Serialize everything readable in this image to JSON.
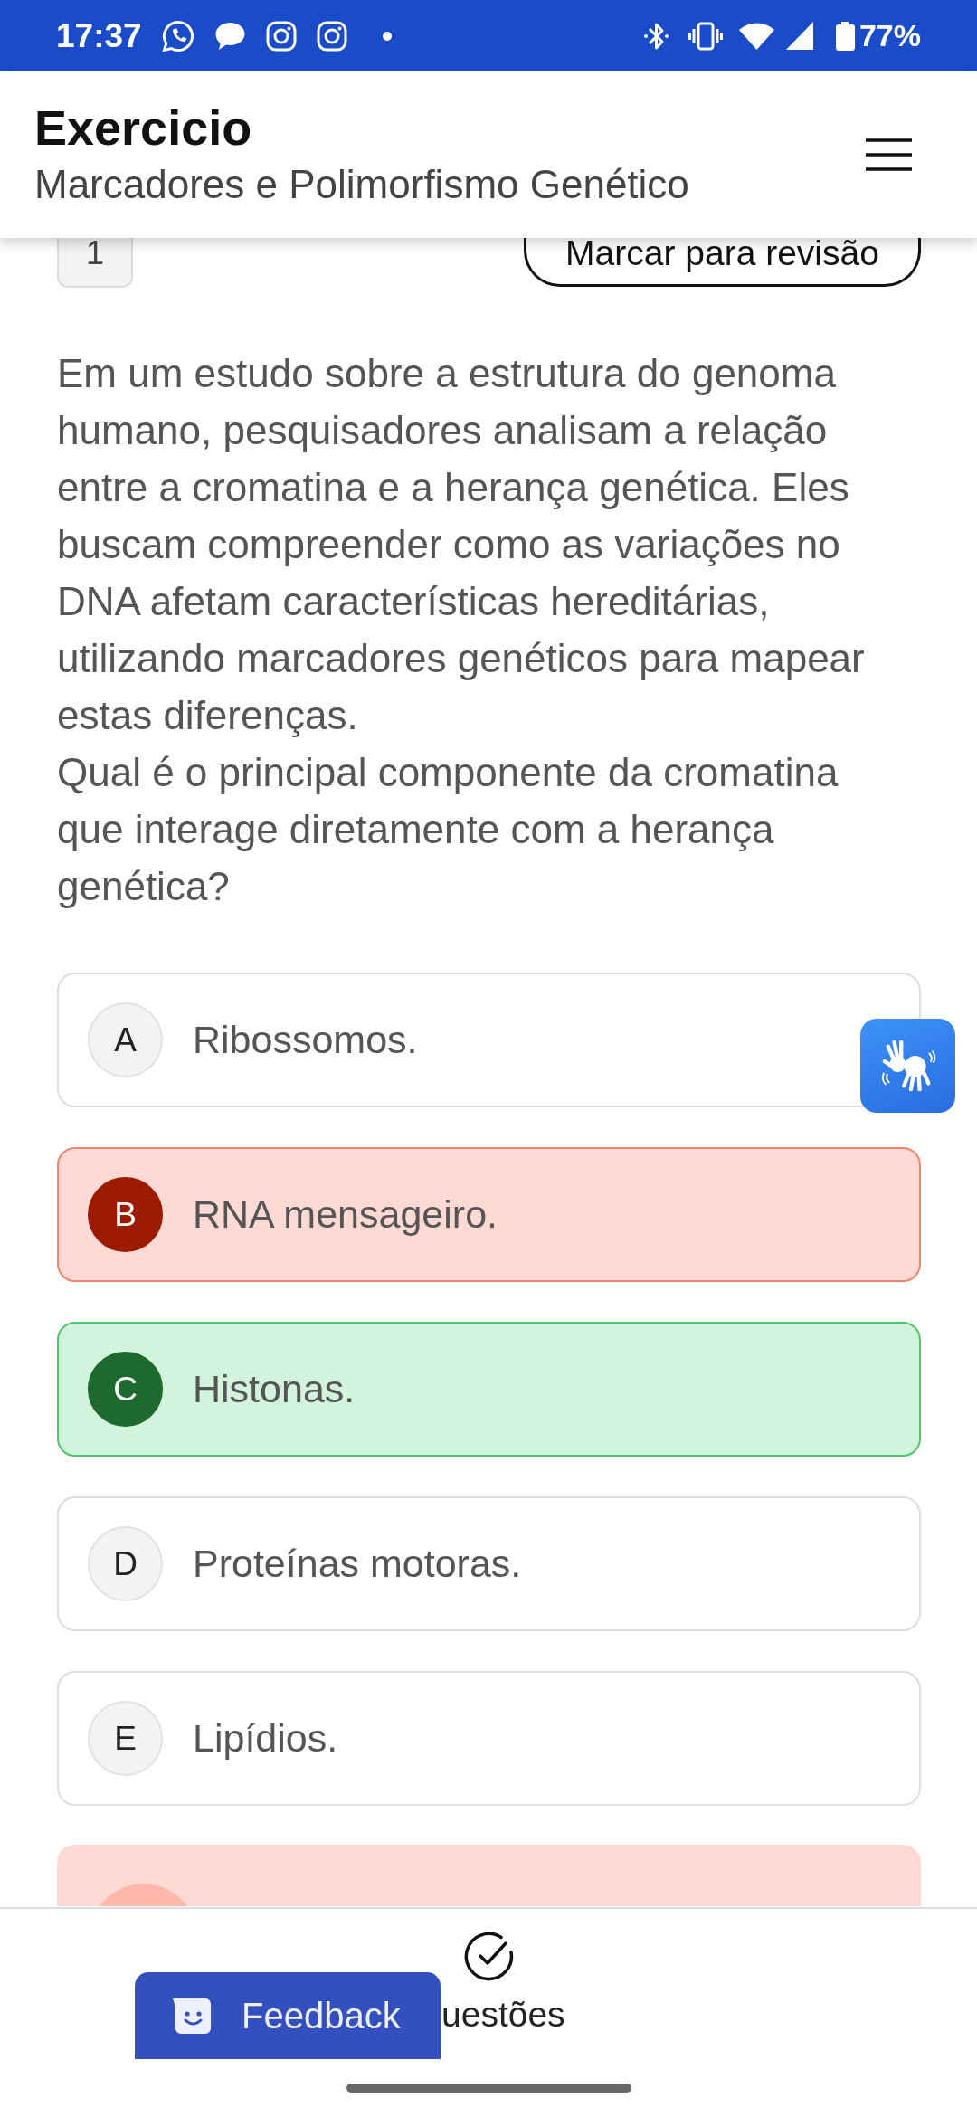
{
  "status_bar": {
    "time": "17:37",
    "battery": "77%"
  },
  "header": {
    "title": "Exercicio",
    "subtitle": "Marcadores e Polimorfismo Genético"
  },
  "question": {
    "number": "1",
    "review_button": "Marcar para revisão",
    "paragraphs": [
      "Em um estudo sobre a estrutura do genoma humano, pesquisadores analisam a relação entre a cromatina e a herança genética. Eles buscam compreender como as variações no DNA afetam características hereditárias, utilizando marcadores genéticos para mapear estas diferenças.",
      "Qual é o principal componente da cromatina que interage diretamente com a herança genética?"
    ]
  },
  "options": [
    {
      "letter": "A",
      "text": "Ribossomos.",
      "selected": false,
      "correct": false
    },
    {
      "letter": "B",
      "text": "RNA mensageiro.",
      "selected": true,
      "correct": false
    },
    {
      "letter": "C",
      "text": "Histonas.",
      "selected": false,
      "correct": true
    },
    {
      "letter": "D",
      "text": "Proteínas motoras.",
      "selected": false,
      "correct": false
    },
    {
      "letter": "E",
      "text": "Lipídios.",
      "selected": false,
      "correct": false
    }
  ],
  "answer_result": {
    "correct": false
  },
  "bottom_nav": {
    "label": "uestões"
  },
  "feedback_button": {
    "label": "Feedback"
  }
}
